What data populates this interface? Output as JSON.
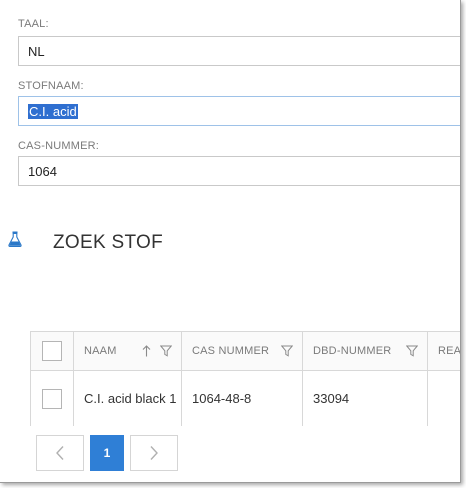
{
  "form": {
    "taal": {
      "label": "TAAL:",
      "value": "NL"
    },
    "stofnaam": {
      "label": "STOFNAAM:",
      "value": "C.I. acid"
    },
    "cas": {
      "label": "CAS-NUMMER:",
      "value": "1064"
    }
  },
  "section": {
    "title": "ZOEK STOF",
    "icon": "flask-icon"
  },
  "table": {
    "columns": [
      {
        "label": "",
        "kind": "checkbox"
      },
      {
        "label": "NAAM",
        "sort_icon": "arrow-up-icon",
        "filter_icon": "filter-icon"
      },
      {
        "label": "CAS NUMMER",
        "filter_icon": "filter-icon"
      },
      {
        "label": "DBD-NUMMER",
        "filter_icon": "filter-icon"
      },
      {
        "label": "REAC"
      }
    ],
    "rows": [
      {
        "naam": "C.I. acid black 1",
        "cas": "1064-48-8",
        "dbd": "33094",
        "reac": ""
      }
    ]
  },
  "pager": {
    "prev_icon": "chevron-left-icon",
    "current_page": "1",
    "next_icon": "chevron-right-icon"
  },
  "colors": {
    "accent": "#2f7fd6",
    "selection": "#2f6fd0",
    "border": "#d8d8d8",
    "label": "#7a7a7a"
  }
}
